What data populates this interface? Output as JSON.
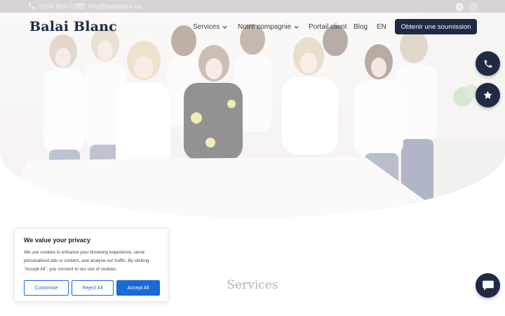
{
  "topbar": {
    "phone": "(514) 883-7152",
    "email": "info@balaiblanc.ca",
    "icons": [
      "phone-icon",
      "mail-icon",
      "facebook-icon",
      "instagram-icon"
    ]
  },
  "header": {
    "logo": "Balai Blanc",
    "nav": [
      {
        "label": "Services",
        "has_dropdown": true
      },
      {
        "label": "Notre compagnie",
        "has_dropdown": true
      },
      {
        "label": "Portail client",
        "has_dropdown": false
      },
      {
        "label": "Blog",
        "has_dropdown": false
      },
      {
        "label": "EN",
        "has_dropdown": false
      }
    ],
    "cta": "Obtenir une soumission"
  },
  "floating": {
    "icons": [
      "phone-icon",
      "star-icon",
      "chat-icon"
    ]
  },
  "main": {
    "services_title": "Services"
  },
  "cookie": {
    "title": "We value your privacy",
    "text": "We use cookies to enhance your browsing experience, serve personalised ads or content, and analyse our traffic. By clicking \"Accept All\", you consent to our use of cookies.",
    "buttons": {
      "customise": "Customise",
      "reject": "Reject All",
      "accept": "Accept All"
    }
  },
  "colors": {
    "brand_navy": "#1f2a44",
    "accent_blue": "#1a6ad6",
    "topbar_bg": "#d9d4d3"
  }
}
